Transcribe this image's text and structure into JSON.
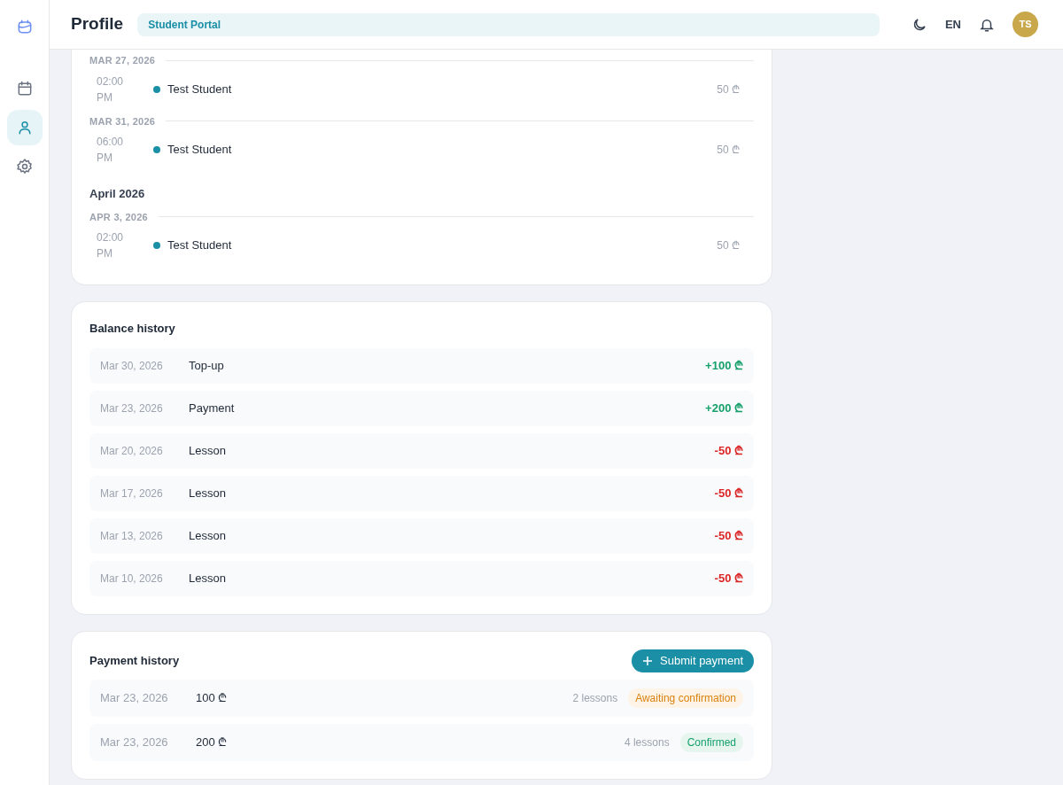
{
  "header": {
    "title": "Profile",
    "badge": "Student Portal",
    "language": "EN",
    "avatar": "TS"
  },
  "sidebar": {
    "items": [
      {
        "kind": "calendar",
        "selected": false
      },
      {
        "kind": "user",
        "selected": true
      },
      {
        "kind": "settings",
        "selected": false
      }
    ]
  },
  "schedule": {
    "groups": [
      {
        "days": [
          {
            "date": "MAR 27, 2026",
            "lessons": [
              {
                "time": "02:00 PM",
                "student": "Test Student",
                "price": "50 ₾"
              }
            ]
          },
          {
            "date": "MAR 31, 2026",
            "lessons": [
              {
                "time": "06:00 PM",
                "student": "Test Student",
                "price": "50 ₾"
              }
            ]
          }
        ]
      },
      {
        "month": "April 2026",
        "days": [
          {
            "date": "APR 3, 2026",
            "lessons": [
              {
                "time": "02:00 PM",
                "student": "Test Student",
                "price": "50 ₾"
              }
            ]
          }
        ]
      }
    ]
  },
  "balance_history": {
    "title": "Balance history",
    "rows": [
      {
        "date": "Mar 30, 2026",
        "description": "Top-up",
        "amount": "+100 ₾",
        "kind": "credit"
      },
      {
        "date": "Mar 23, 2026",
        "description": "Payment",
        "amount": "+200 ₾",
        "kind": "credit"
      },
      {
        "date": "Mar 20, 2026",
        "description": "Lesson",
        "amount": "-50 ₾",
        "kind": "debit"
      },
      {
        "date": "Mar 17, 2026",
        "description": "Lesson",
        "amount": "-50 ₾",
        "kind": "debit"
      },
      {
        "date": "Mar 13, 2026",
        "description": "Lesson",
        "amount": "-50 ₾",
        "kind": "debit"
      },
      {
        "date": "Mar 10, 2026",
        "description": "Lesson",
        "amount": "-50 ₾",
        "kind": "debit"
      }
    ]
  },
  "payment_history": {
    "title": "Payment history",
    "button": "Submit payment",
    "rows": [
      {
        "date": "Mar 23, 2026",
        "amount": "100 ₾",
        "lessons": "2 lessons",
        "status": "Awaiting confirmation",
        "kind": "pending"
      },
      {
        "date": "Mar 23, 2026",
        "amount": "200 ₾",
        "lessons": "4 lessons",
        "status": "Confirmed",
        "kind": "confirmed"
      }
    ]
  }
}
